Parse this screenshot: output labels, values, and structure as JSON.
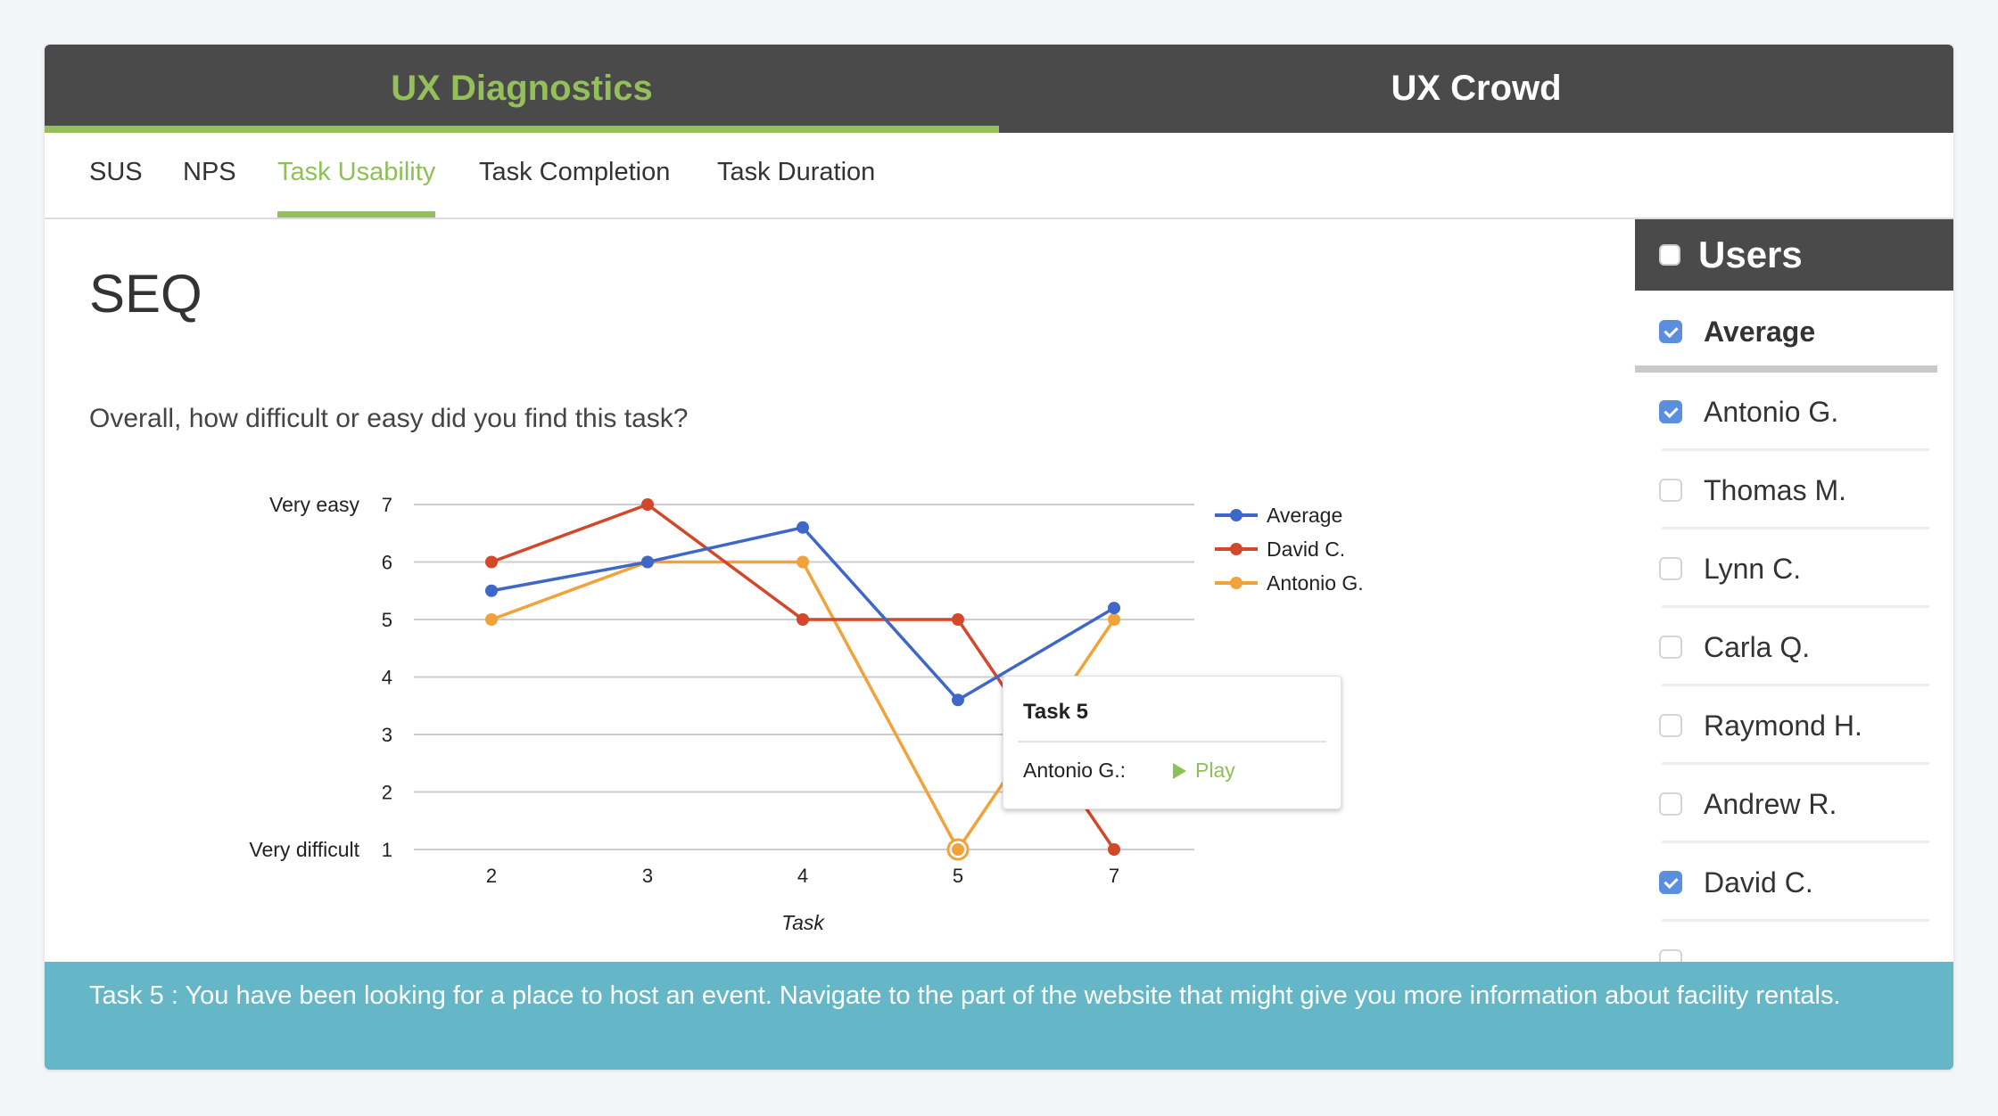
{
  "header": {
    "tabs": [
      {
        "label": "UX Diagnostics",
        "active": true
      },
      {
        "label": "UX Crowd",
        "active": false
      }
    ]
  },
  "subtabs": [
    {
      "label": "SUS",
      "active": false
    },
    {
      "label": "NPS",
      "active": false
    },
    {
      "label": "Task Usability",
      "active": true
    },
    {
      "label": "Task Completion",
      "active": false
    },
    {
      "label": "Task Duration",
      "active": false
    }
  ],
  "main": {
    "title": "SEQ",
    "question": "Overall, how difficult or easy did you find this task?"
  },
  "colors": {
    "accent_green": "#95bf5a",
    "header_dark": "#4a4a4a",
    "footer_teal": "#65b6c6",
    "checkbox_blue": "#5b8fdd"
  },
  "chart_data": {
    "type": "line",
    "title": "",
    "xlabel": "Task",
    "ylabel": "",
    "categories": [
      "2",
      "3",
      "4",
      "5",
      "7"
    ],
    "ylim": [
      1,
      7
    ],
    "yticks": [
      1,
      2,
      3,
      4,
      5,
      6,
      7
    ],
    "y_annotations": {
      "7": "Very easy",
      "1": "Very difficult"
    },
    "grid": true,
    "legend_position": "right",
    "series": [
      {
        "name": "Average",
        "color": "#3f67c8",
        "values": [
          5.5,
          6,
          6.6,
          3.6,
          5.2
        ]
      },
      {
        "name": "David C.",
        "color": "#d2482a",
        "values": [
          6,
          7,
          5,
          5,
          1
        ]
      },
      {
        "name": "Antonio G.",
        "color": "#f2a23a",
        "values": [
          5,
          6,
          6,
          1,
          5
        ]
      }
    ],
    "highlighted_point": {
      "series": "Antonio G.",
      "category": "5"
    }
  },
  "tooltip": {
    "title": "Task 5",
    "label": "Antonio G.:",
    "action": "Play"
  },
  "sidebar": {
    "title": "Users",
    "header_checked": false,
    "items": [
      {
        "name": "Average",
        "checked": true
      },
      {
        "name": "Antonio G.",
        "checked": true
      },
      {
        "name": "Thomas M.",
        "checked": false
      },
      {
        "name": "Lynn C.",
        "checked": false
      },
      {
        "name": "Carla Q.",
        "checked": false
      },
      {
        "name": "Raymond H.",
        "checked": false
      },
      {
        "name": "Andrew R.",
        "checked": false
      },
      {
        "name": "David C.",
        "checked": true
      }
    ]
  },
  "footer": {
    "text": "Task 5 : You have been looking for a place to host an event. Navigate to the part of the website that might give you more information about facility rentals."
  }
}
